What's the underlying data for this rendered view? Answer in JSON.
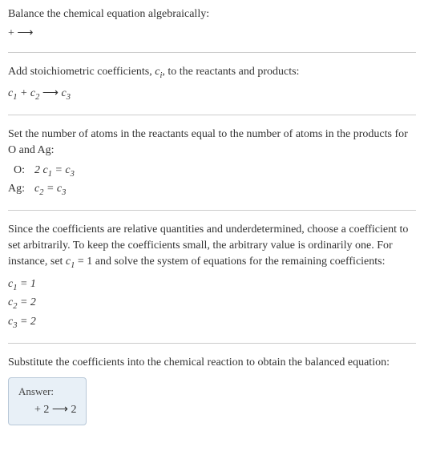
{
  "section1": {
    "title": "Balance the chemical equation algebraically:",
    "equation": " +  ⟶ "
  },
  "section2": {
    "title": "Add stoichiometric coefficients, c_i, to the reactants and products:",
    "equation_parts": {
      "c1": "c",
      "s1": "1",
      "plus": " + ",
      "c2": "c",
      "s2": "2",
      "arrow": "  ⟶  ",
      "c3": "c",
      "s3": "3"
    }
  },
  "section3": {
    "title": "Set the number of atoms in the reactants equal to the number of atoms in the products for O and Ag:",
    "rows": [
      {
        "label": "O:",
        "lhs_c": "2 c",
        "lhs_s": "1",
        "eq": " = ",
        "rhs_c": "c",
        "rhs_s": "3"
      },
      {
        "label": "Ag:",
        "lhs_c": "c",
        "lhs_s": "2",
        "eq": " = ",
        "rhs_c": "c",
        "rhs_s": "3"
      }
    ]
  },
  "section4": {
    "title_a": "Since the coefficients are relative quantities and underdetermined, choose a coefficient to set arbitrarily. To keep the coefficients small, the arbitrary value is ordinarily one. For instance, set ",
    "set_c": "c",
    "set_s": "1",
    "set_val": " = 1",
    "title_b": " and solve the system of equations for the remaining coefficients:",
    "coeffs": [
      {
        "c": "c",
        "s": "1",
        "v": " = 1"
      },
      {
        "c": "c",
        "s": "2",
        "v": " = 2"
      },
      {
        "c": "c",
        "s": "3",
        "v": " = 2"
      }
    ]
  },
  "section5": {
    "title": "Substitute the coefficients into the chemical reaction to obtain the balanced equation:",
    "answer_label": "Answer:",
    "answer_eq": " + 2   ⟶  2 "
  }
}
